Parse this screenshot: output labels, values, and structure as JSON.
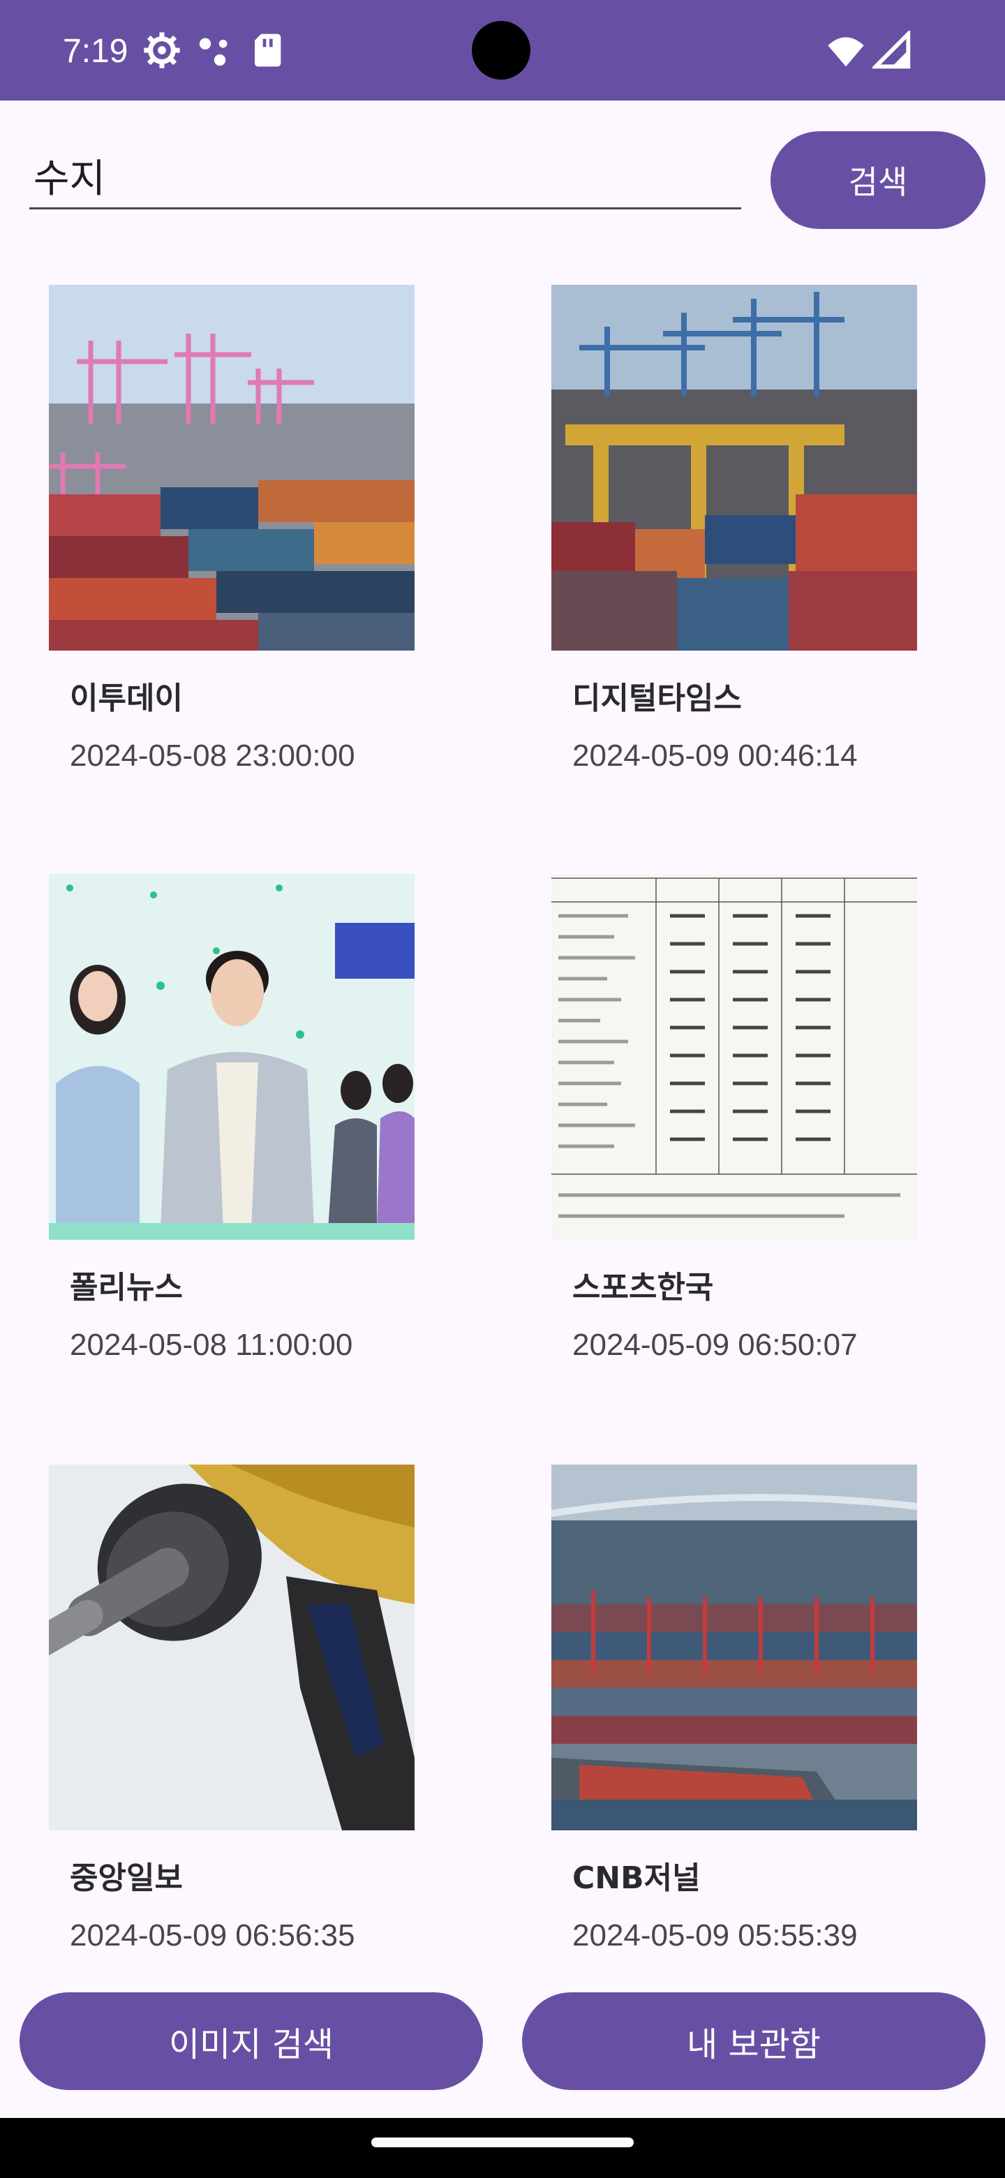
{
  "status_bar": {
    "time": "7:19",
    "icons": [
      "settings-icon",
      "notification-dots-icon",
      "sim-card-icon",
      "wifi-icon",
      "signal-icon"
    ],
    "color": "#6750a4"
  },
  "search": {
    "value": "수지",
    "button_label": "검색"
  },
  "results": [
    {
      "source": "이투데이",
      "date": "2024-05-08 23:00:00",
      "image": "port-container-cranes"
    },
    {
      "source": "디지털타임스",
      "date": "2024-05-09 00:46:14",
      "image": "port-container-terminal"
    },
    {
      "source": "폴리뉴스",
      "date": "2024-05-08 11:00:00",
      "image": "business-people-banner"
    },
    {
      "source": "스포츠한국",
      "date": "2024-05-09 06:50:07",
      "image": "statistics-table"
    },
    {
      "source": "중앙일보",
      "date": "2024-05-09 06:56:35",
      "image": "fuel-nozzle"
    },
    {
      "source": "CNB저널",
      "date": "2024-05-09 05:55:39",
      "image": "port-aerial-view"
    }
  ],
  "bottom_buttons": {
    "image_search": "이미지 검색",
    "my_archive": "내 보관함"
  },
  "colors": {
    "accent": "#6750a4",
    "background": "#fdf7ff"
  }
}
